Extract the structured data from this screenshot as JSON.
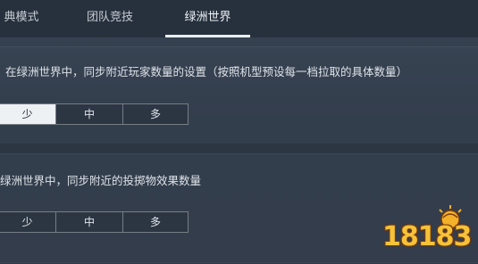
{
  "tabs": [
    {
      "label": "典模式"
    },
    {
      "label": "团队竞技"
    },
    {
      "label": "绿洲世界"
    }
  ],
  "settings": [
    {
      "label": "在绿洲世界中，同步附近玩家数量的设置（按照机型预设每一档拉取的具体数量）",
      "options": [
        "少",
        "中",
        "多"
      ],
      "selected": "少"
    },
    {
      "label": "绿洲世界中，同步附近的投掷物效果数量",
      "options": [
        "少",
        "中",
        "多"
      ],
      "selected": "少"
    }
  ],
  "watermark": {
    "text": "18183"
  },
  "colors": {
    "accent": "#eef1f4",
    "logo": "#f5c23a"
  }
}
